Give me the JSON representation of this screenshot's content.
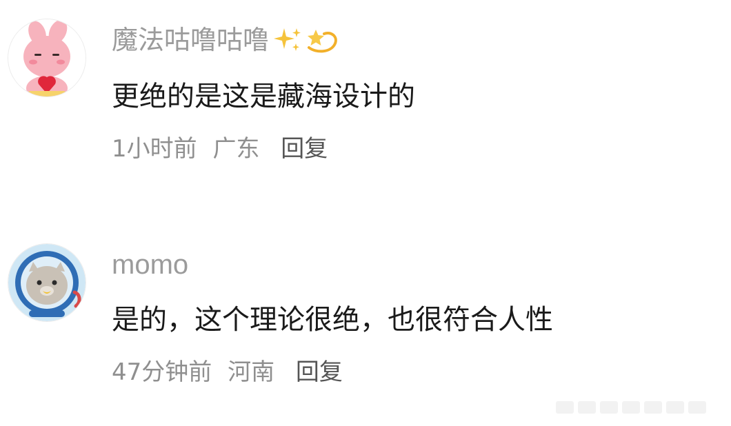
{
  "comments": [
    {
      "username": "魔法咕噜咕噜",
      "emoji_icons": [
        "sparkles-icon",
        "dizzy-star-icon"
      ],
      "text": "更绝的是这是藏海设计的",
      "time": "1小时前",
      "location": "广东",
      "reply_label": "回复",
      "avatar_icon": "pink-bunny-avatar"
    },
    {
      "username": "momo",
      "text": "是的，这个理论很绝，也很符合人性",
      "time": "47分钟前",
      "location": "河南",
      "reply_label": "回复",
      "avatar_icon": "astronaut-seal-avatar"
    }
  ],
  "colors": {
    "username": "#9b9b9b",
    "text": "#1a1a1a",
    "meta": "#8f8f8f",
    "reply": "#555555"
  }
}
